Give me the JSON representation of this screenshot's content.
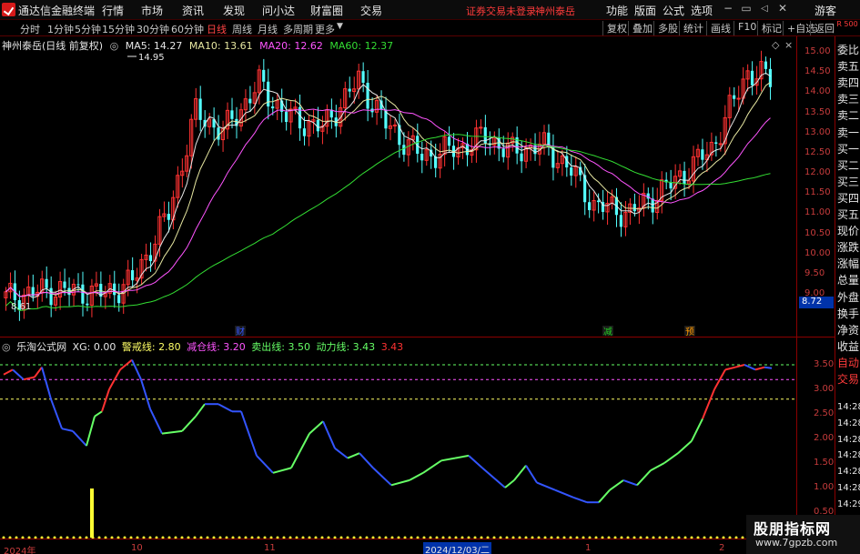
{
  "titlebar": {
    "app_name": "通达信金融终端",
    "menus": [
      "行情",
      "市场",
      "资讯",
      "发现",
      "问小达",
      "财富圈",
      "交易"
    ],
    "notice": "证券交易未登录",
    "stock": "神州泰岳",
    "right_menus": [
      "功能",
      "版面",
      "公式",
      "选项"
    ],
    "guest": "游客"
  },
  "toolbar": {
    "periods": [
      "分时",
      "1分钟",
      "5分钟",
      "15分钟",
      "30分钟",
      "60分钟",
      "日线",
      "周线",
      "月线",
      "多周期",
      "更多"
    ],
    "active": "日线",
    "right_buttons": [
      "复权",
      "叠加",
      "多股",
      "统计",
      "画线",
      "F10",
      "标记",
      "+自选",
      "返回"
    ]
  },
  "main": {
    "title": "神州泰岳(日线 前复权)",
    "ma5": "MA5: 14.27",
    "ma10": "MA10: 13.61",
    "ma20": "MA20: 12.62",
    "ma60": "MA60: 12.37",
    "high_label": "14.95",
    "low_label": "8.61",
    "current_tag": "8.72",
    "y_ticks": [
      "15.00",
      "14.50",
      "14.00",
      "13.50",
      "13.00",
      "12.50",
      "12.00",
      "11.50",
      "11.00",
      "10.50",
      "10.00",
      "9.50",
      "9.00"
    ],
    "events": [
      "财",
      "减",
      "预"
    ],
    "colors": {
      "up": "#ff3232",
      "down": "#54ffff",
      "ma5": "#e6e6e6",
      "ma10": "#e6e6a0",
      "ma20": "#ff55ff",
      "ma60": "#33dd33"
    }
  },
  "right_sidebar": {
    "corner": "R 500",
    "items": [
      "委比",
      "卖五",
      "卖四",
      "卖三",
      "卖二",
      "卖一",
      "买一",
      "买二",
      "买三",
      "买四",
      "买五",
      "现价",
      "涨跌",
      "涨幅",
      "总量",
      "外盘",
      "换手",
      "净资",
      "收益",
      "自动",
      "交易"
    ],
    "times": [
      "14:28",
      "14:28",
      "14:28",
      "14:28",
      "14:28",
      "14:28",
      "14:29",
      "14:29",
      "14:29"
    ]
  },
  "indicator": {
    "name": "乐淘公式网",
    "xg": "XG: 0.00",
    "warn": "警戒线: 2.80",
    "reduce": "减仓线: 3.20",
    "sell": "卖出线: 3.50",
    "power": "动力线: 3.43",
    "power_val": "3.43",
    "y_ticks": [
      "3.50",
      "3.00",
      "2.50",
      "2.00",
      "1.50",
      "1.00",
      "0.50"
    ]
  },
  "xaxis": {
    "labels": [
      "2024年",
      "10",
      "11",
      "1",
      "2"
    ],
    "selected": "2024/12/03/二"
  },
  "watermark": {
    "line1": "股朋指标网",
    "line2": "www.7gpzb.com"
  }
}
